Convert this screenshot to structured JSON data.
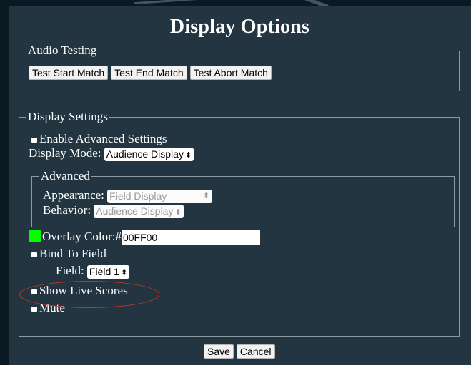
{
  "title": "Display Options",
  "audio_testing": {
    "legend": "Audio Testing",
    "buttons": [
      "Test Start Match",
      "Test End Match",
      "Test Abort Match"
    ]
  },
  "display_settings": {
    "legend": "Display Settings",
    "enable_advanced": {
      "label": "Enable Advanced Settings",
      "checked": false
    },
    "display_mode": {
      "label": "Display Mode:",
      "value": "Audience Display"
    },
    "advanced": {
      "legend": "Advanced",
      "appearance": {
        "label": "Appearance:",
        "value": "Field Display"
      },
      "behavior": {
        "label": "Behavior:",
        "value": "Audience Display"
      }
    },
    "overlay_color": {
      "label": "Overlay Color:#",
      "value": "00FF00",
      "swatch_color": "#00ff00"
    },
    "bind_to_field": {
      "label": "Bind To Field",
      "checked": false
    },
    "field": {
      "label": "Field:",
      "value": "Field 1"
    },
    "show_live_scores": {
      "label": "Show Live Scores",
      "checked": false,
      "highlighted": true
    },
    "mute": {
      "label": "Mute",
      "checked": false
    }
  },
  "footer": {
    "save": "Save",
    "cancel": "Cancel"
  },
  "colors": {
    "panel": "#223540",
    "annotation": "#c0392b",
    "swatch": "#00ff00"
  },
  "icons": {
    "select_arrows": "⬍"
  }
}
